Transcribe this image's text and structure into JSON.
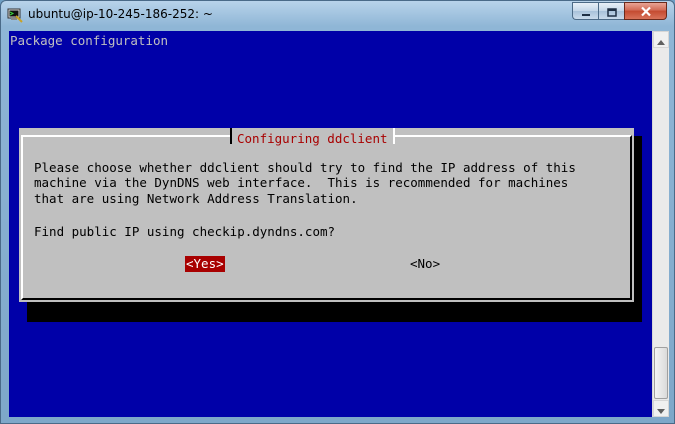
{
  "window": {
    "title": "ubuntu@ip-10-245-186-252: ~"
  },
  "terminal": {
    "header": "Package configuration"
  },
  "dialog": {
    "title": "Configuring ddclient",
    "message_lines": [
      "Please choose whether ddclient should try to find the IP address of this",
      "machine via the DynDNS web interface.  This is recommended for machines",
      "that are using Network Address Translation."
    ],
    "question": "Find public IP using checkip.dyndns.com?",
    "yes_label": "<Yes>",
    "no_label": "<No>"
  },
  "colors": {
    "terminal_bg": "#0000a8",
    "dialog_bg": "#c0c0c0",
    "title_text": "#a80000",
    "selected_button_bg": "#a80000"
  },
  "icons": {
    "app": "putty-terminal-icon",
    "minimize": "minimize-icon",
    "maximize": "maximize-icon",
    "close": "close-icon"
  }
}
